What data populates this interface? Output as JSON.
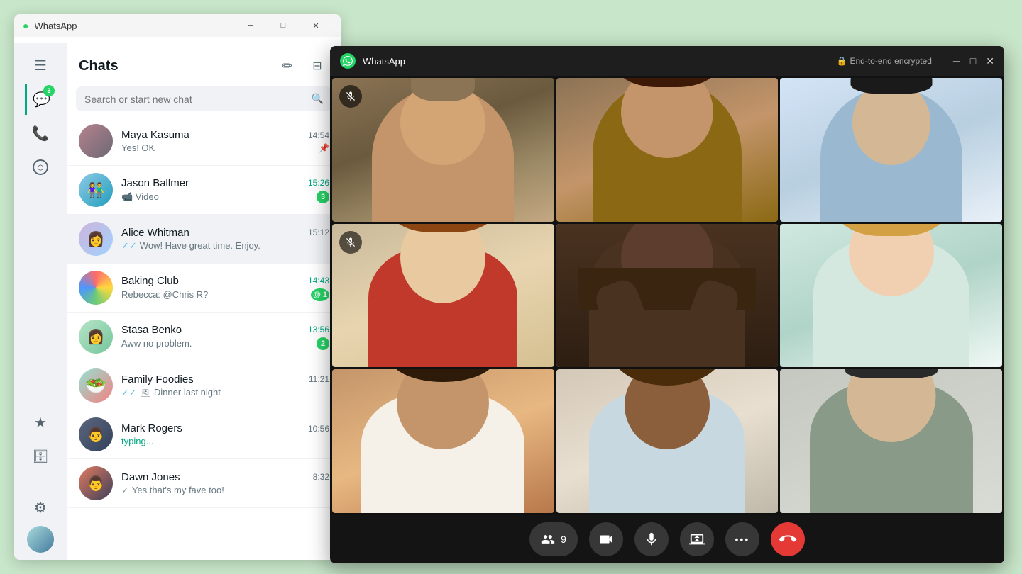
{
  "app": {
    "title": "WhatsApp",
    "encryption_label": "End-to-end encrypted"
  },
  "main_window": {
    "title": "WhatsApp"
  },
  "sidebar": {
    "badge_count": "3",
    "items": [
      {
        "id": "menu",
        "icon": "☰",
        "label": "Menu",
        "active": false
      },
      {
        "id": "chats",
        "icon": "💬",
        "label": "Chats",
        "active": true,
        "badge": "3"
      },
      {
        "id": "calls",
        "icon": "📞",
        "label": "Calls",
        "active": false
      },
      {
        "id": "status",
        "icon": "⊙",
        "label": "Status",
        "active": false
      },
      {
        "id": "starred",
        "icon": "★",
        "label": "Starred",
        "active": false
      },
      {
        "id": "archived",
        "icon": "🗄",
        "label": "Archived",
        "active": false
      },
      {
        "id": "settings",
        "icon": "⚙",
        "label": "Settings",
        "active": false
      }
    ]
  },
  "chats_panel": {
    "title": "Chats",
    "new_chat_label": "New chat",
    "filter_label": "Filter",
    "search_placeholder": "Search or start new chat",
    "chat_list": [
      {
        "id": "maya",
        "name": "Maya Kasuma",
        "preview": "Yes! OK",
        "time": "14:54",
        "unread": false,
        "pinned": true,
        "avatar_class": "av-maya"
      },
      {
        "id": "jason",
        "name": "Jason Ballmer",
        "preview": "📹 Video",
        "time": "15:26",
        "unread": true,
        "badge": "3",
        "avatar_class": "av-jason"
      },
      {
        "id": "alice",
        "name": "Alice Whitman",
        "preview": "✓✓ Wow! Have great time. Enjoy.",
        "time": "15:12",
        "unread": false,
        "active": true,
        "avatar_class": "av-alice"
      },
      {
        "id": "baking",
        "name": "Baking Club",
        "preview": "Rebecca: @Chris R?",
        "time": "14:43",
        "unread": true,
        "badge": "1",
        "mention": true,
        "avatar_class": "av-baking"
      },
      {
        "id": "stasa",
        "name": "Stasa Benko",
        "preview": "Aww no problem.",
        "time": "13:56",
        "unread": true,
        "badge": "2",
        "avatar_class": "av-stasa"
      },
      {
        "id": "family",
        "name": "Family Foodies",
        "preview": "✓✓ 🖼 Dinner last night",
        "time": "11:21",
        "unread": false,
        "avatar_class": "av-family"
      },
      {
        "id": "mark",
        "name": "Mark Rogers",
        "preview": "typing...",
        "preview_typing": true,
        "time": "10:56",
        "unread": false,
        "avatar_class": "av-mark"
      },
      {
        "id": "dawn",
        "name": "Dawn Jones",
        "preview": "✓ Yes that's my fave too!",
        "time": "8:32",
        "unread": false,
        "avatar_class": "av-dawn"
      }
    ]
  },
  "video_call": {
    "participants_count": "9",
    "controls": [
      {
        "id": "participants",
        "icon": "👥",
        "label": "9"
      },
      {
        "id": "video",
        "icon": "📹",
        "label": "Video"
      },
      {
        "id": "mic",
        "icon": "🎤",
        "label": "Mic"
      },
      {
        "id": "screen",
        "icon": "⬆",
        "label": "Share screen"
      },
      {
        "id": "more",
        "icon": "…",
        "label": "More"
      },
      {
        "id": "end",
        "icon": "📞",
        "label": "End call"
      }
    ],
    "grid_cells": [
      {
        "id": 1,
        "muted": true,
        "bg": "vc-1"
      },
      {
        "id": 2,
        "muted": false,
        "bg": "vc-2"
      },
      {
        "id": 3,
        "muted": false,
        "bg": "vc-3"
      },
      {
        "id": 4,
        "muted": true,
        "bg": "vc-4"
      },
      {
        "id": 5,
        "highlighted": true,
        "muted": false,
        "bg": "vc-5"
      },
      {
        "id": 6,
        "muted": false,
        "bg": "vc-6"
      },
      {
        "id": 7,
        "muted": false,
        "bg": "vc-7"
      },
      {
        "id": 8,
        "muted": false,
        "bg": "vc-8"
      },
      {
        "id": 9,
        "muted": false,
        "bg": "vc-9"
      }
    ]
  },
  "icons": {
    "search": "🔍",
    "new_chat": "✏",
    "filter": "⊟",
    "lock": "🔒",
    "minimize": "—",
    "maximize": "□",
    "close": "✕",
    "whatsapp": "W",
    "mic_off": "🎙",
    "participants": "👥",
    "video_cam": "📹",
    "microphone": "🎤",
    "share_screen": "⬆",
    "more_options": "•••",
    "end_call": "📞"
  }
}
